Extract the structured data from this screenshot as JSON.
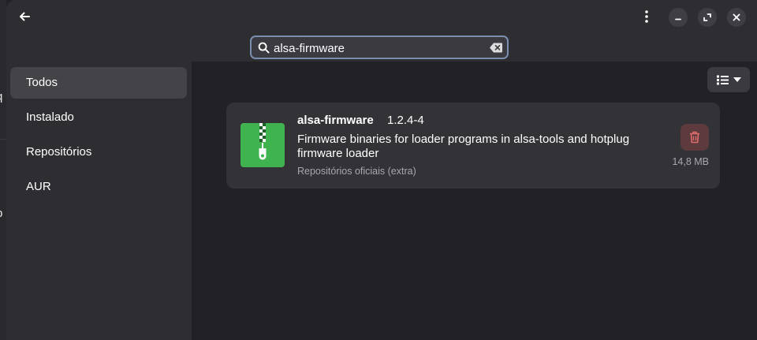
{
  "background_window": {
    "fragments": [
      "q",
      "b"
    ]
  },
  "header": {
    "search": {
      "value": "alsa-firmware",
      "placeholder": ""
    },
    "icons": {
      "back": "arrow-left-icon",
      "menu": "kebab-menu-icon",
      "minimize": "minimize-icon",
      "maximize": "maximize-icon",
      "close": "close-icon",
      "search": "search-icon",
      "clear": "clear-text-icon"
    }
  },
  "sidebar": {
    "items": [
      {
        "label": "Todos",
        "active": true
      },
      {
        "label": "Instalado",
        "active": false
      },
      {
        "label": "Repositórios",
        "active": false
      },
      {
        "label": "AUR",
        "active": false
      }
    ]
  },
  "toolbar": {
    "view_icon": "list-view-icon",
    "dropdown_icon": "chevron-down-icon"
  },
  "results": [
    {
      "name": "alsa-firmware",
      "version": "1.2.4-4",
      "description": "Firmware binaries for loader programs in alsa-tools and hotplug firmware loader",
      "source": "Repositórios oficiais (extra)",
      "size": "14,8 MB",
      "icon": "archive-zip-icon",
      "action_icon": "trash-icon"
    }
  ],
  "colors": {
    "accent_border": "#7a8fb0",
    "app_icon_bg": "#3fb34f",
    "remove_bg": "#5c3a3d",
    "remove_icon": "#e06c6c"
  }
}
